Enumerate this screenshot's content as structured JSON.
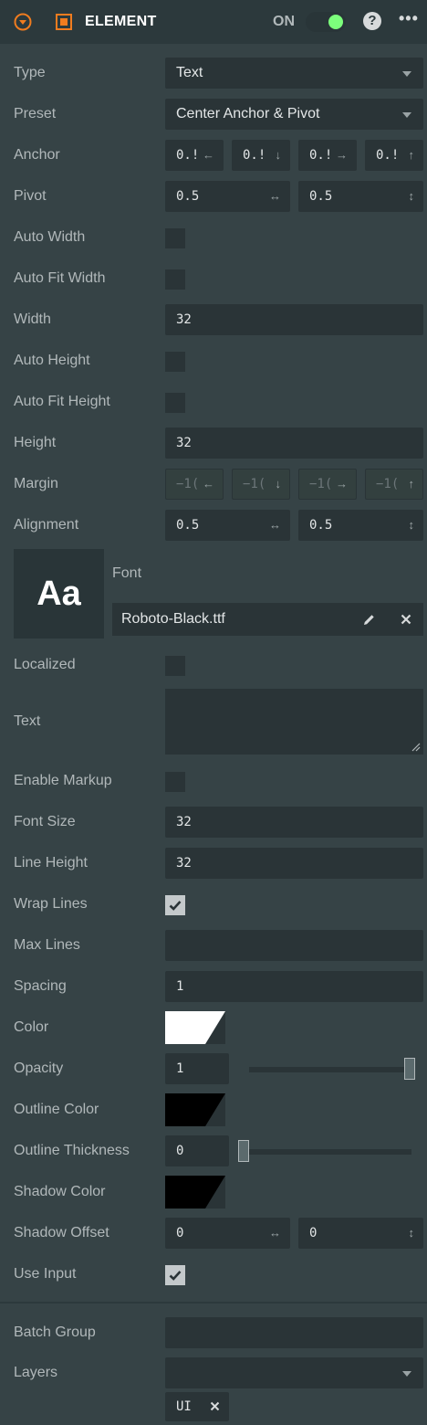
{
  "header": {
    "title": "ELEMENT",
    "toggle_label": "ON",
    "help": "?",
    "more": "•••"
  },
  "labels": {
    "type": "Type",
    "preset": "Preset",
    "anchor": "Anchor",
    "pivot": "Pivot",
    "auto_width": "Auto Width",
    "auto_fit_width": "Auto Fit Width",
    "width": "Width",
    "auto_height": "Auto Height",
    "auto_fit_height": "Auto Fit Height",
    "height": "Height",
    "margin": "Margin",
    "alignment": "Alignment",
    "font": "Font",
    "localized": "Localized",
    "text": "Text",
    "enable_markup": "Enable Markup",
    "font_size": "Font Size",
    "line_height": "Line Height",
    "wrap_lines": "Wrap Lines",
    "max_lines": "Max Lines",
    "spacing": "Spacing",
    "color": "Color",
    "opacity": "Opacity",
    "outline_color": "Outline Color",
    "outline_thickness": "Outline Thickness",
    "shadow_color": "Shadow Color",
    "shadow_offset": "Shadow Offset",
    "use_input": "Use Input",
    "batch_group": "Batch Group",
    "layers": "Layers"
  },
  "values": {
    "type": "Text",
    "preset": "Center Anchor & Pivot",
    "anchor": [
      "0.!",
      "0.!",
      "0.!",
      "0.!"
    ],
    "pivot": [
      "0.5",
      "0.5"
    ],
    "width": "32",
    "height": "32",
    "margin": [
      "−1(",
      "−1(",
      "−1(",
      "−1("
    ],
    "alignment": [
      "0.5",
      "0.5"
    ],
    "font_preview": "Aa",
    "font_file": "Roboto-Black.ttf",
    "font_size": "32",
    "line_height": "32",
    "max_lines": "",
    "spacing": "1",
    "opacity": "1",
    "opacity_fraction": 1.0,
    "outline_thickness": "0",
    "outline_thickness_fraction": 0.0,
    "shadow_offset": [
      "0",
      "0"
    ],
    "batch_group": "",
    "layer_tag": "UI"
  },
  "checks": {
    "auto_width": false,
    "auto_fit_width": false,
    "auto_height": false,
    "auto_fit_height": false,
    "localized": false,
    "enable_markup": false,
    "wrap_lines": true,
    "use_input": true
  },
  "arrows": {
    "left": "←",
    "down": "↓",
    "right": "→",
    "up": "↑",
    "horizontal": "↔",
    "vertical": "↕"
  },
  "colors": {
    "accent": "#f07c1f",
    "toggle_on": "#7cff7c",
    "color_swatch": "#ffffff",
    "outline_swatch": "#000000",
    "shadow_swatch": "#000000"
  }
}
